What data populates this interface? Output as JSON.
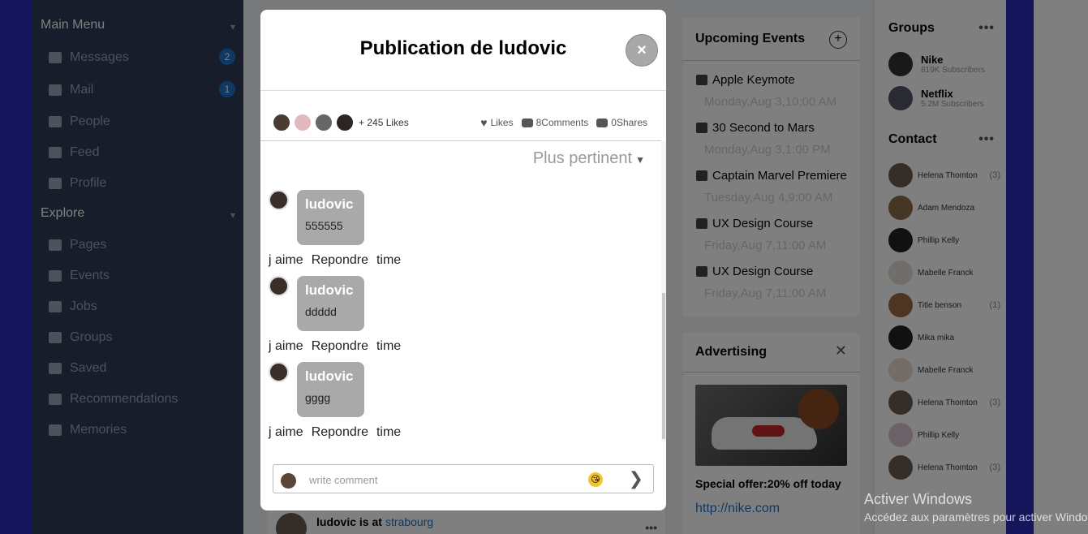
{
  "sidebar": {
    "main_menu": "Main Menu",
    "items": [
      {
        "label": "Messages",
        "badge": "2"
      },
      {
        "label": "Mail",
        "badge": "1"
      },
      {
        "label": "People"
      },
      {
        "label": "Feed"
      },
      {
        "label": "Profile"
      }
    ],
    "explore": "Explore",
    "explore_items": [
      "Pages",
      "Events",
      "Jobs",
      "Groups",
      "Saved",
      "Recommendations",
      "Memories"
    ]
  },
  "events": {
    "title": "Upcoming Events",
    "items": [
      {
        "name": "Apple Keymote",
        "date": "Monday,Aug 3,10:00 AM"
      },
      {
        "name": "30 Second to Mars",
        "date": "Monday,Aug 3,1:00 PM"
      },
      {
        "name": "Captain Marvel Premiere",
        "date": "Tuesday,Aug 4,9:00 AM"
      },
      {
        "name": "UX Design Course",
        "date": "Friday,Aug 7,11:00 AM"
      },
      {
        "name": "UX Design Course",
        "date": "Friday,Aug 7,11:00 AM"
      }
    ]
  },
  "advertising": {
    "title": "Advertising",
    "offer": "Special offer:20% off today",
    "link": "http://nike.com"
  },
  "groups": {
    "title": "Groups",
    "items": [
      {
        "name": "Nike",
        "subs": "819K Subscribers"
      },
      {
        "name": "Netflix",
        "subs": "5.2M Subscribers"
      }
    ]
  },
  "contacts": {
    "title": "Contact",
    "items": [
      {
        "name": "Helena Thomton",
        "count": "(3)"
      },
      {
        "name": "Adam Mendoza",
        "count": ""
      },
      {
        "name": "Phillip Kelly",
        "count": ""
      },
      {
        "name": "Mabelle Franck",
        "count": ""
      },
      {
        "name": "Title benson",
        "count": "(1)"
      },
      {
        "name": "Mika mika",
        "count": ""
      },
      {
        "name": "Mabelle Franck",
        "count": ""
      },
      {
        "name": "Helena Thomton",
        "count": "(3)"
      },
      {
        "name": "Phillip Kelly",
        "count": ""
      },
      {
        "name": "Helena Thomton",
        "count": "(3)"
      }
    ]
  },
  "feed": {
    "post_author": "ludovic is at",
    "post_location": "strabourg"
  },
  "modal": {
    "title": "Publication de ludovic",
    "close": "×",
    "likes_count": "+ 245 Likes",
    "likes_label": "Likes",
    "comments_label": "8Comments",
    "shares_label": "0Shares",
    "sort_label": "Plus pertinent",
    "comments": [
      {
        "author": "ludovic",
        "text": "555555",
        "like": "j aime",
        "reply": "Repondre",
        "time": "time"
      },
      {
        "author": "ludovic",
        "text": "ddddd",
        "like": "j aime",
        "reply": "Repondre",
        "time": "time"
      },
      {
        "author": "ludovic",
        "text": "gggg",
        "like": "j aime",
        "reply": "Repondre",
        "time": "time"
      }
    ],
    "comment_placeholder": "write comment"
  },
  "watermark": {
    "title": "Activer Windows",
    "subtitle": "Accédez aux paramètres pour activer Windows."
  },
  "colors": {
    "sidebar_bg": "#2f3b55",
    "edge_blue": "#2b2bb8",
    "bubble": "#a9a9a9",
    "badge": "#1a73c9"
  }
}
